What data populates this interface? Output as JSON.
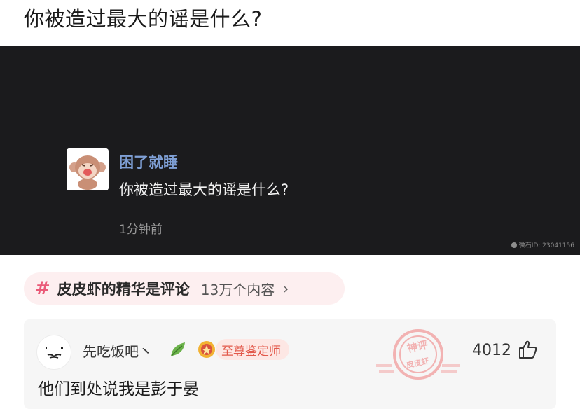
{
  "page": {
    "title": "你被造过最大的谣是什么?"
  },
  "video": {
    "author": "困了就睡",
    "text": "你被造过最大的谣是什么?",
    "time": "1分钟前",
    "watermark": "微石ID: 23041156"
  },
  "topic": {
    "hash": "#",
    "name": "皮皮虾的精华是评论",
    "count": "13万个内容",
    "chevron": "›"
  },
  "comment": {
    "username": "先吃饭吧丶",
    "badge": "至尊鉴定师",
    "text": "他们到处说我是彭于晏",
    "likes": "4012",
    "stamp_top": "神评",
    "stamp_bottom": "皮皮虾"
  },
  "colors": {
    "accent_pink": "#ea5a78",
    "author_blue": "#7fa0d6",
    "badge_red": "#e2584a",
    "panel_dark": "#1b1b1d"
  },
  "icons": [
    "monkey-avatar-icon",
    "leaf-icon",
    "medal-icon",
    "thumbs-up-icon",
    "chevron-right-icon"
  ]
}
